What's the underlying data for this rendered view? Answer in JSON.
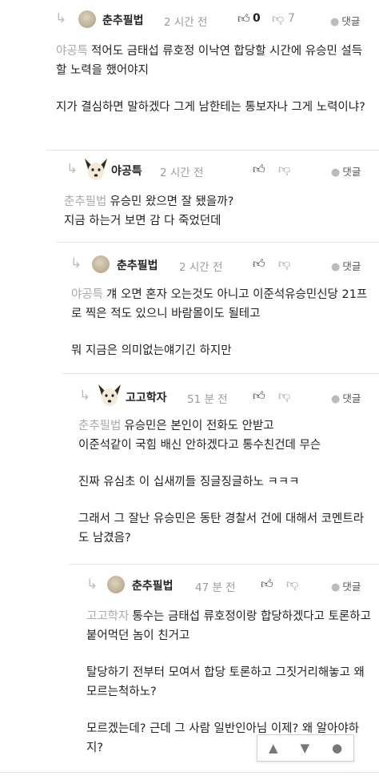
{
  "icons": {
    "reply_arrow": "reply-arrow-icon",
    "like": "thumb-up-icon",
    "dislike": "thumb-down-icon",
    "reply": "comment-bubble-icon",
    "up": "arrow-up-icon",
    "down": "arrow-down-icon"
  },
  "comments": [
    {
      "nick": "춘추필법",
      "time": "2 시간 전",
      "likes": "0",
      "dislikes": "7",
      "reply_label": "댓글",
      "mention": "야공특",
      "paragraphs": [
        "적어도 금태섭 류호정 이낙연 합당할 시간에 유승민 설득할 노력을 했어야지",
        "지가 결심하면 말하겠다 그게 남한테는 통보자나 그게 노력이냐?"
      ]
    },
    {
      "nick": "야공특",
      "time": "2 시간 전",
      "reply_label": "댓글",
      "mention": "춘추필법",
      "paragraphs": [
        "유승민 왔으면 잘 됐을까?\n지금 하는거 보면 감 다 죽었던데"
      ]
    },
    {
      "nick": "춘추필법",
      "time": "2 시간 전",
      "reply_label": "댓글",
      "mention": "야공특",
      "paragraphs": [
        "걔 오면 혼자 오는것도 아니고 이준석유승민신당 21프로 찍은 적도 있으니 바람몰이도 될테고",
        "뭐 지금은 의미없는얘기긴 하지만"
      ]
    },
    {
      "nick": "고고학자",
      "time": "51 분 전",
      "reply_label": "댓글",
      "mention": "춘추필법",
      "paragraphs": [
        "유승민은 본인이 전화도 안받고\n이준석같이 국힘 배신 안하겠다고 통수친건데 무슨",
        "진짜 유심초 이 십새끼들 징글징글하노 ㅋㅋㅋ",
        "그래서 그 잘난 유승민은 동탄 경찰서 건에 대해서 코멘트라도 남겼음?"
      ]
    },
    {
      "nick": "춘추필법",
      "time": "47 분 전",
      "reply_label": "댓글",
      "mention": "고고학자",
      "paragraphs": [
        "통수는 금태섭 류호정이랑 합당하겠다고 토론하고 붙어먹던 놈이 친거고",
        "탈당하기 전부터 모여서 합당 토론하고 그짓거리해놓고 왜 모르는척하노?",
        "모르겠는데? 근데 그 사람 일반인아님 이제? 왜 알아야하지?"
      ]
    }
  ]
}
